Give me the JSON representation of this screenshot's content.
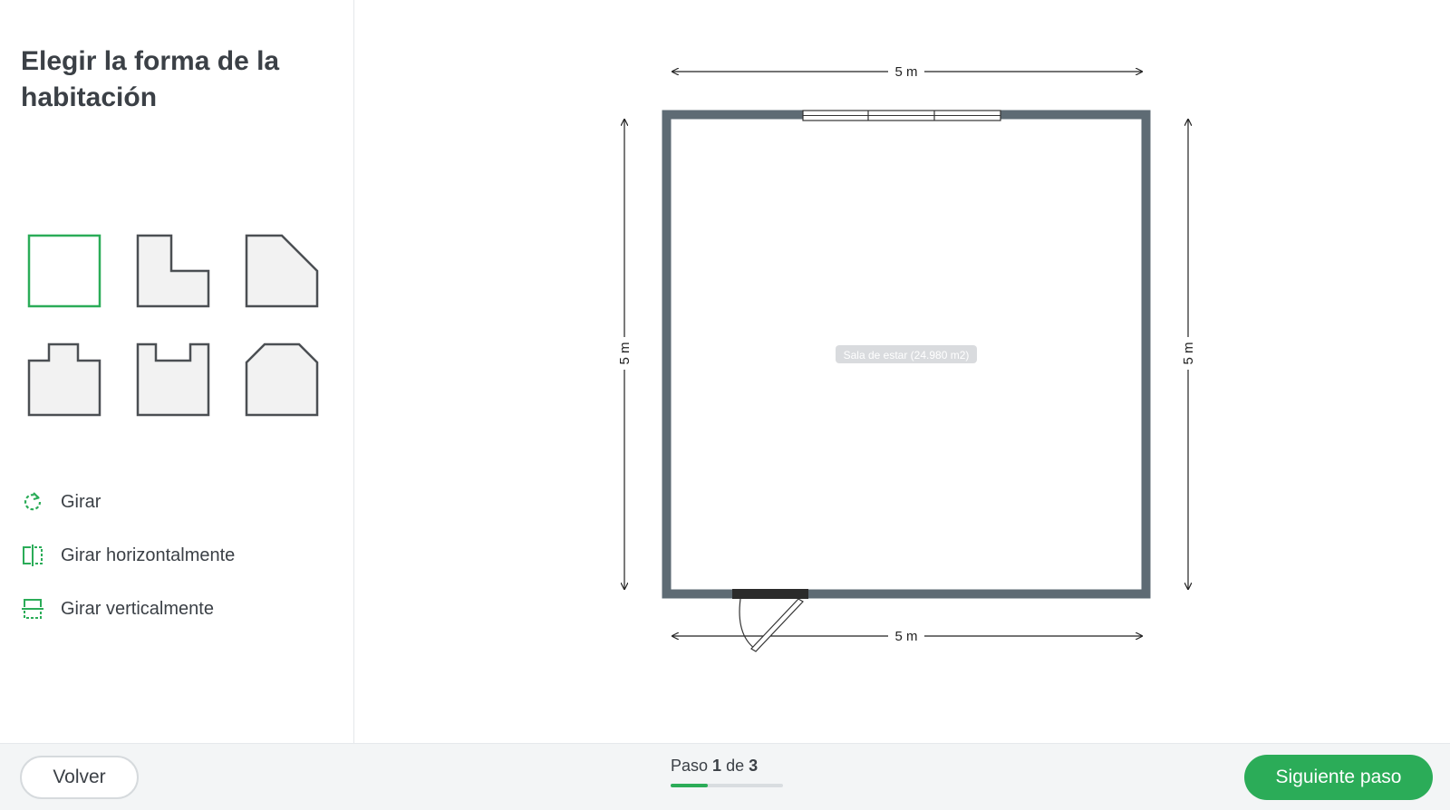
{
  "sidebar": {
    "title": "Elegir la forma de la habitación",
    "shapes": [
      {
        "name": "square",
        "selected": true
      },
      {
        "name": "l-shape",
        "selected": false
      },
      {
        "name": "cut-corner",
        "selected": false
      },
      {
        "name": "t-shape",
        "selected": false
      },
      {
        "name": "u-shape",
        "selected": false
      },
      {
        "name": "pentagon",
        "selected": false
      }
    ],
    "tools": [
      {
        "label": "Girar",
        "icon": "rotate-icon"
      },
      {
        "label": "Girar horizontalmente",
        "icon": "flip-horizontal-icon"
      },
      {
        "label": "Girar verticalmente",
        "icon": "flip-vertical-icon"
      }
    ]
  },
  "canvas": {
    "room_label": "Sala de estar (24.980 m2)",
    "dim_top": "5 m",
    "dim_bottom": "5 m",
    "dim_left": "5 m",
    "dim_right": "5 m"
  },
  "footer": {
    "back_label": "Volver",
    "step_prefix": "Paso",
    "step_current": "1",
    "step_of": "de",
    "step_total": "3",
    "progress": 0.33,
    "next_label": "Siguiente paso"
  },
  "colors": {
    "accent": "#2bac58",
    "wall": "#5e6b74",
    "shape_fill": "#f2f2f2",
    "shape_stroke": "#4b4f53"
  }
}
